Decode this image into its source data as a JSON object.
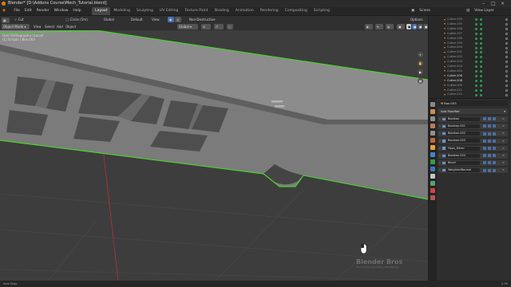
{
  "window": {
    "title": "Blender* [D:\\Addons Course\\Mech_Tutorial.blend]"
  },
  "menu": {
    "items": [
      "File",
      "Edit",
      "Render",
      "Window",
      "Help"
    ],
    "workspaces": [
      "Layout",
      "Modeling",
      "Sculpting",
      "UV Editing",
      "Texture Paint",
      "Shading",
      "Animation",
      "Rendering",
      "Compositing",
      "Scripting"
    ],
    "active_workspace": "Layout",
    "scene": "Scene",
    "view_layer": "View Layer"
  },
  "viewport_header": {
    "mode": "Object Mode",
    "view": "View",
    "select": "Select",
    "add": "Add",
    "object": "Object",
    "tool_select": "Cut",
    "tool_shape": "Circle (5m)",
    "transform": "Global",
    "pivot": "Default",
    "view2": "View",
    "edit_mode": "Non-Destructive",
    "gizmo_orient": "Global",
    "options": "Options"
  },
  "viewport": {
    "info_line1": "User Orthographic (Local)",
    "info_line2": "(1) Scripts | Box.003"
  },
  "outliner": {
    "items": [
      "Cutter.194",
      "Cutter.195",
      "Cutter.196",
      "Cutter.197",
      "Cutter.198",
      "Cutter.199",
      "Cutter.200",
      "Cutter.201",
      "Cutter.202",
      "Cutter.203",
      "Cutter.204",
      "Cutter.205",
      "Cutter.206",
      "Cutter.208",
      "Cutter.209",
      "Cutter.211",
      "Cutter.212"
    ],
    "highlighted": [
      "Cutter.206",
      "Cutter.208"
    ]
  },
  "properties": {
    "object_name": "Box.003",
    "section_title": "Add Modifier",
    "modifiers": [
      "Boolean",
      "Boolean.001",
      "Boolean.002",
      "Boolean.003",
      "Hops_Mirror",
      "Boolean.004",
      "Bevel",
      "WeightedNormal"
    ]
  },
  "status": {
    "left": "Axis Snap",
    "right": "2.90"
  },
  "watermark": {
    "brand": "Blender Bros",
    "tagline": "Hard Surface Modeling with Blender"
  },
  "colors": {
    "selection_outline": "#4ad12e",
    "model_top": "#8f8f8f",
    "model_face": "#7a7a7a",
    "viewport_bg": "#3d3d3d",
    "accent_orange": "#d08c3c"
  }
}
